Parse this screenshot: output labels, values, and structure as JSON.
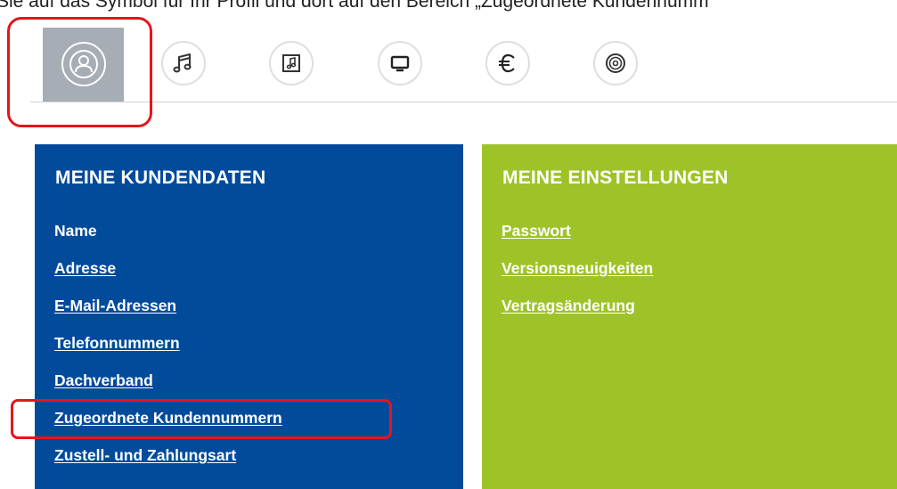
{
  "instruction_text": "Sie auf das Symbol für Ihr Profil und dort auf den Bereich „Zugeordnete Kundennumm",
  "icon_bar": {
    "icons": [
      {
        "name": "profile-icon"
      },
      {
        "name": "music-note-icon"
      },
      {
        "name": "music-sheet-icon"
      },
      {
        "name": "monitor-icon"
      },
      {
        "name": "euro-icon"
      },
      {
        "name": "disc-icon"
      }
    ]
  },
  "customer_panel": {
    "title": "MEINE KUNDENDATEN",
    "items": [
      {
        "label": "Name",
        "link": false
      },
      {
        "label": "Adresse",
        "link": true
      },
      {
        "label": "E-Mail-Adressen",
        "link": true
      },
      {
        "label": "Telefonnummern",
        "link": true
      },
      {
        "label": "Dachverband",
        "link": true
      },
      {
        "label": "Zugeordnete Kundennummern",
        "link": true
      },
      {
        "label": "Zustell- und Zahlungsart",
        "link": true
      }
    ]
  },
  "settings_panel": {
    "title": "MEINE EINSTELLUNGEN",
    "items": [
      {
        "label": "Passwort",
        "link": true
      },
      {
        "label": "Versionsneuigkeiten",
        "link": true
      },
      {
        "label": "Vertragsänderung",
        "link": true
      }
    ]
  },
  "colors": {
    "customer_panel_bg": "#024b9b",
    "settings_panel_bg": "#9ec329",
    "highlight_red": "#e8141b",
    "profile_tile_bg": "#a7adb4"
  }
}
